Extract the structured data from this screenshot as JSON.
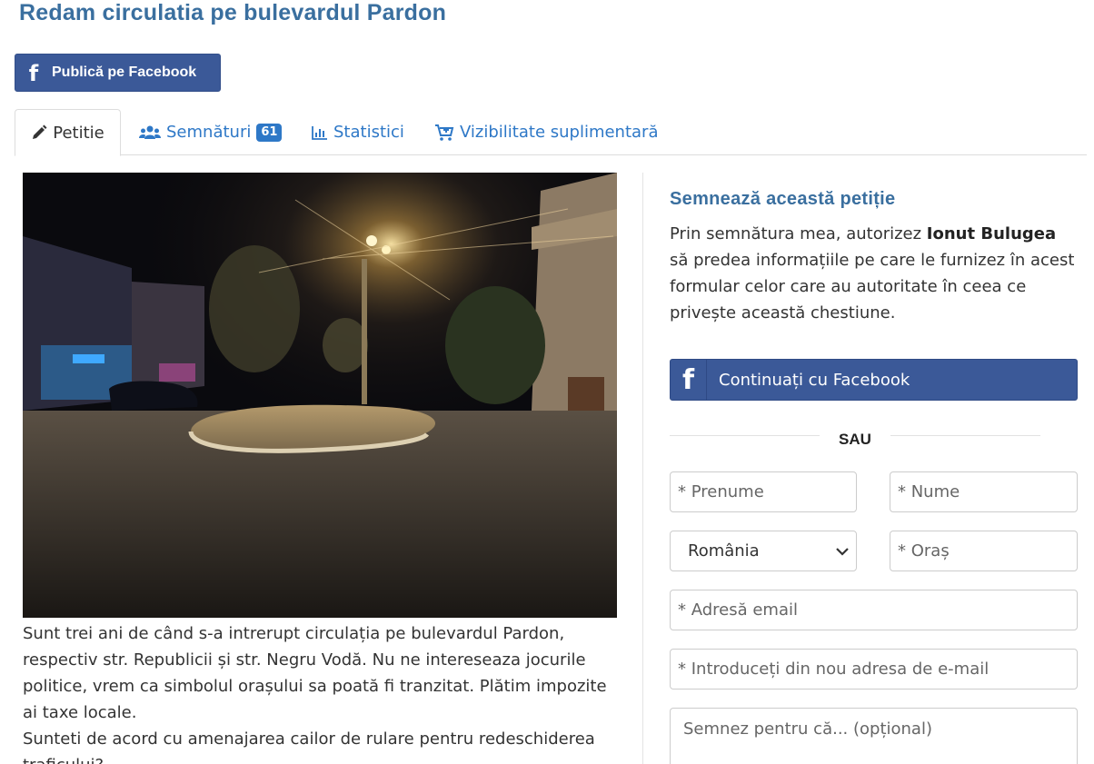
{
  "page": {
    "title": "Redam circulatia pe bulevardul Pardon"
  },
  "share": {
    "facebook_label": "Publică pe Facebook"
  },
  "tabs": [
    {
      "label": "Petitie",
      "icon": "pencil-icon"
    },
    {
      "label": "Semnături",
      "icon": "users-icon",
      "count": "61"
    },
    {
      "label": "Statistici",
      "icon": "bar-chart-icon"
    },
    {
      "label": "Vizibilitate suplimentară",
      "icon": "cart-plus-icon"
    }
  ],
  "petition": {
    "paragraph": "Sunt trei ani de când s-a intrerupt circulația pe bulevardul Pardon, respectiv str. Republicii și str. Negru Vodă. Nu ne intereseaza jocurile politice, vrem ca simbolul orașului sa poată fi tranzitat. Plătim impozite ai taxe locale.",
    "question": "Sunteti de acord cu amenajarea cailor de rulare pentru redeschiderea traficului?"
  },
  "sign": {
    "title": "Semnează această petiție",
    "text_before": "Prin semnătura mea, autorizez ",
    "author": "Ionut Bulugea",
    "text_after": " să predea informațiile pe care le furnizez în acest formular celor care au autoritate în ceea ce privește această chestiune.",
    "facebook_label": "Continuați cu Facebook",
    "or_label": "SAU"
  },
  "form": {
    "first_name_placeholder": "* Prenume",
    "last_name_placeholder": "* Nume",
    "country_value": "România",
    "city_placeholder": "* Oraș",
    "email_placeholder": "* Adresă email",
    "email_confirm_placeholder": "* Introduceți din nou adresa de e-mail",
    "reason_placeholder": "Semnez pentru că... (opțional)"
  },
  "colors": {
    "facebook": "#3b5998",
    "link": "#2e78c7",
    "heading": "#3a6f9f"
  }
}
